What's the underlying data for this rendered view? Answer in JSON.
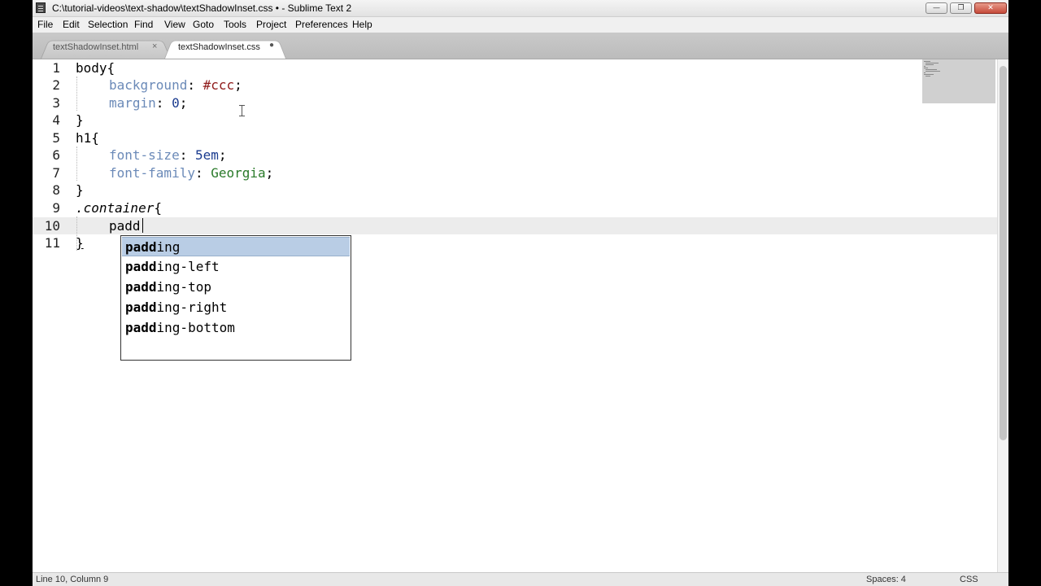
{
  "window": {
    "title": "C:\\tutorial-videos\\text-shadow\\textShadowInset.css • - Sublime Text 2",
    "minimize": "—",
    "maximize": "❐",
    "close": "✕"
  },
  "menu": [
    "File",
    "Edit",
    "Selection",
    "Find",
    "View",
    "Goto",
    "Tools",
    "Project",
    "Preferences",
    "Help"
  ],
  "tabs": [
    {
      "label": "textShadowInset.html",
      "close": "×"
    },
    {
      "label": "textShadowInset.css",
      "dirty": "●"
    }
  ],
  "editor": {
    "line_numbers": [
      "1",
      "2",
      "3",
      "4",
      "5",
      "6",
      "7",
      "8",
      "9",
      "10",
      "11"
    ],
    "lines": {
      "l1_sel": "body",
      "l1_brace": "{",
      "l2_prop": "background",
      "l2_colon": ": ",
      "l2_val": "#ccc",
      "l2_semi": ";",
      "l3_prop": "margin",
      "l3_colon": ": ",
      "l3_val": "0",
      "l3_semi": ";",
      "l4": "}",
      "l5_sel": "h1",
      "l5_brace": "{",
      "l6_prop": "font-size",
      "l6_colon": ": ",
      "l6_val": "5em",
      "l6_semi": ";",
      "l7_prop": "font-family",
      "l7_colon": ": ",
      "l7_val": "Georgia",
      "l7_semi": ";",
      "l8": "}",
      "l9_sel": ".container",
      "l9_brace": "{",
      "l10": "padd",
      "l11": "}"
    }
  },
  "autocomplete": {
    "items": [
      {
        "match": "padd",
        "rest": "ing"
      },
      {
        "match": "padd",
        "rest": "ing-left"
      },
      {
        "match": "padd",
        "rest": "ing-top"
      },
      {
        "match": "padd",
        "rest": "ing-right"
      },
      {
        "match": "padd",
        "rest": "ing-bottom"
      }
    ],
    "selected_index": 0
  },
  "status": {
    "position": "Line 10, Column 9",
    "indent": "Spaces: 4",
    "syntax": "CSS"
  },
  "colors": {
    "property": "#6b8ab8",
    "color_value": "#8f1a1a",
    "number_value": "#1a3b8f",
    "font_value": "#2a7a2a",
    "autocomplete_selected": "#b9cde5"
  }
}
